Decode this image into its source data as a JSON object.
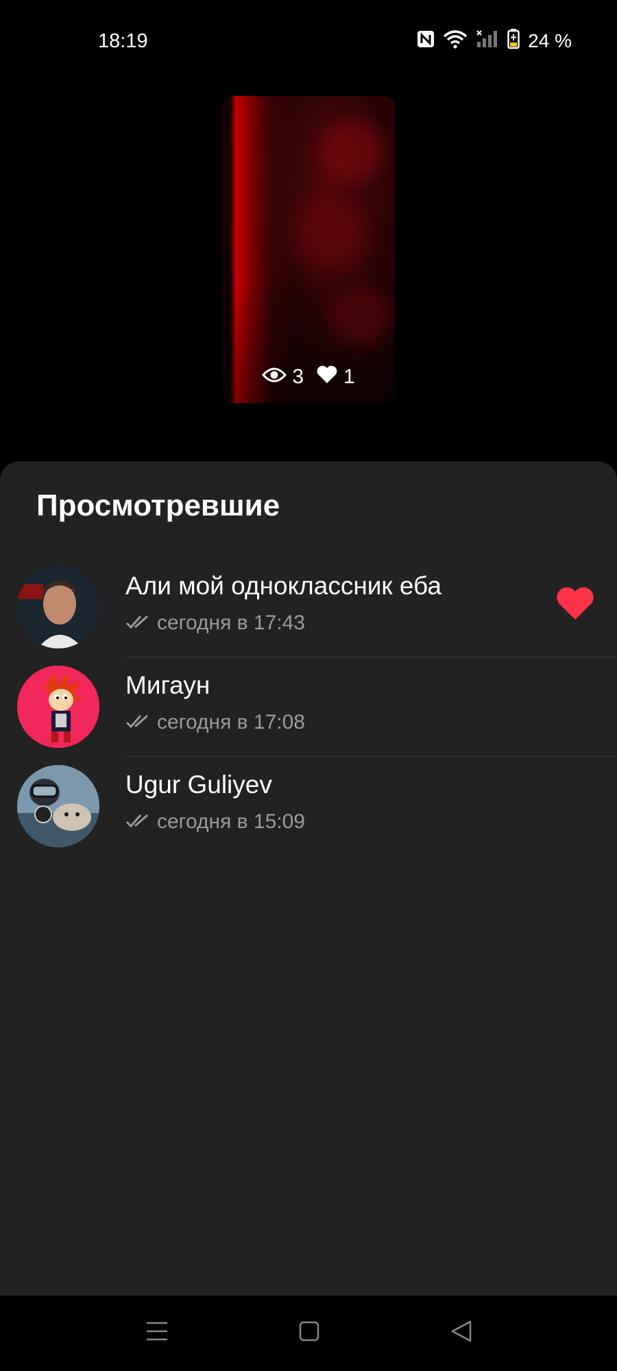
{
  "status_bar": {
    "time": "18:19",
    "battery": "24 %",
    "icons": [
      "nfc-icon",
      "wifi-icon",
      "signal-icon",
      "battery-icon"
    ]
  },
  "story": {
    "views": "3",
    "likes": "1"
  },
  "sheet": {
    "title": "Просмотревшие",
    "viewers": [
      {
        "name": "Али мой одноклассник еба",
        "time": "сегодня в 17:43",
        "liked": true
      },
      {
        "name": "Мигаун",
        "time": "сегодня в 17:08",
        "liked": false
      },
      {
        "name": "Ugur Guliyev",
        "time": "сегодня в 15:09",
        "liked": false
      }
    ]
  },
  "colors": {
    "accent_like": "#ff3347",
    "sheet_bg": "#222222",
    "secondary_text": "#9a9a9a"
  },
  "navigation": [
    "menu-icon",
    "home-icon",
    "back-icon"
  ]
}
